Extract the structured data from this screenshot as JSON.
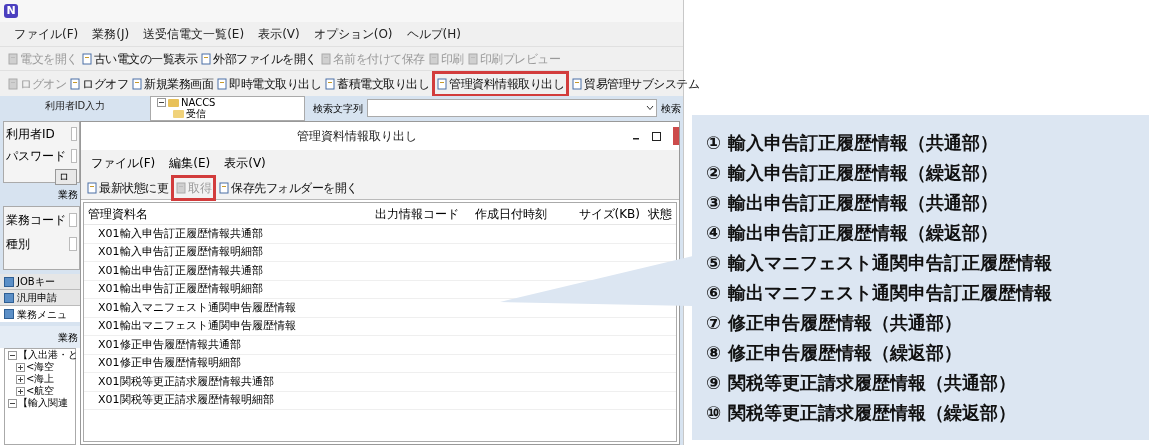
{
  "app": {
    "logo": "N",
    "menu": [
      "ファイル(F)",
      "業務(J)",
      "送受信電文一覧(E)",
      "表示(V)",
      "オプション(O)",
      "ヘルプ(H)"
    ],
    "toolbar_1": [
      {
        "label": "電文を開く",
        "disabled": true
      },
      {
        "label": "古い電文の一覧表示",
        "disabled": false
      },
      {
        "label": "外部ファイルを開く",
        "disabled": false
      },
      {
        "label": "名前を付けて保存",
        "disabled": true
      },
      {
        "label": "印刷",
        "disabled": true
      },
      {
        "label": "印刷プレビュー",
        "disabled": true
      }
    ],
    "toolbar_2": [
      {
        "label": "ログオン",
        "disabled": true,
        "highlighted": false
      },
      {
        "label": "ログオフ",
        "disabled": false,
        "highlighted": false
      },
      {
        "label": "新規業務画面",
        "disabled": false,
        "highlighted": false
      },
      {
        "label": "即時電文取り出し",
        "disabled": false,
        "highlighted": false
      },
      {
        "label": "蓄積電文取り出し",
        "disabled": false,
        "highlighted": false
      },
      {
        "label": "管理資料情報取り出し",
        "disabled": false,
        "highlighted": true
      },
      {
        "label": "貿易管理サブシステム",
        "disabled": false,
        "highlighted": false
      }
    ],
    "user_panel": {
      "title": "利用者ID入力",
      "fields": [
        "利用者ID",
        "パスワード"
      ],
      "button": "ロ"
    },
    "folder_tree": [
      {
        "label": "NACCS",
        "expanded": true,
        "children": [
          {
            "label": "受信"
          }
        ]
      }
    ],
    "search": {
      "label": "検索文字列",
      "button": "検索"
    },
    "task_panel": {
      "title": "業務",
      "fields": [
        "業務コード",
        "種別"
      ]
    },
    "tabs": [
      {
        "label": "JOBキー",
        "selected": false
      },
      {
        "label": "汎用申請",
        "selected": false
      },
      {
        "label": "業務メニュ",
        "selected": true
      }
    ],
    "menu_panel": {
      "title": "業務",
      "tree": [
        {
          "label": "【入出港・と",
          "expanded": true,
          "children": [
            {
              "label": "<海空",
              "expanded": false
            },
            {
              "label": "<海上",
              "expanded": false
            },
            {
              "label": "<航空",
              "expanded": false
            }
          ]
        },
        {
          "label": "【輸入関連",
          "expanded": true
        }
      ]
    }
  },
  "dialog": {
    "title": "管理資料情報取り出し",
    "menu": [
      "ファイル(F)",
      "編集(E)",
      "表示(V)"
    ],
    "toolbar": [
      {
        "label": "最新状態に更",
        "disabled": false,
        "highlighted": false
      },
      {
        "label": "取得",
        "disabled": true,
        "highlighted": true
      },
      {
        "label": "保存先フォルダーを開く",
        "disabled": false,
        "highlighted": false
      }
    ],
    "columns": [
      "管理資料名",
      "出力情報コード",
      "作成日付時刻",
      "サイズ(KB)",
      "状態"
    ],
    "rows": [
      "X01輸入申告訂正履歴情報共通部",
      "X01輸入申告訂正履歴情報明細部",
      "X01輸出申告訂正履歴情報共通部",
      "X01輸出申告訂正履歴情報明細部",
      "X01輸入マニフェスト通関申告履歴情報",
      "X01輸出マニフェスト通関申告履歴情報",
      "X01修正申告履歴情報共通部",
      "X01修正申告履歴情報明細部",
      "X01関税等更正請求履歴情報共通部",
      "X01関税等更正請求履歴情報明細部"
    ]
  },
  "callout": {
    "items": [
      "① 輸入申告訂正履歴情報（共通部）",
      "② 輸入申告訂正履歴情報（繰返部）",
      "③ 輸出申告訂正履歴情報（共通部）",
      "④ 輸出申告訂正履歴情報（繰返部）",
      "⑤ 輸入マニフェスト通関申告訂正履歴情報",
      "⑥ 輸出マニフェスト通関申告訂正履歴情報",
      "⑦ 修正申告履歴情報（共通部）",
      "⑧ 修正申告履歴情報（繰返部）",
      "⑨ 関税等更正請求履歴情報（共通部）",
      "⑩ 関税等更正請求履歴情報（繰返部）"
    ]
  }
}
